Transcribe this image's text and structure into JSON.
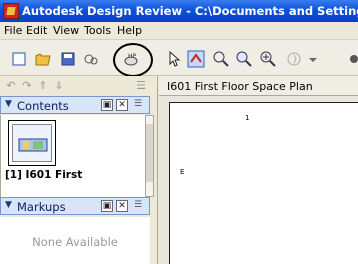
{
  "window": {
    "title": "Autodesk Design Review - C:\\Documents and Settings\\admini"
  },
  "menu": [
    "File",
    "Edit",
    "View",
    "Tools",
    "Help"
  ],
  "toolbar": {
    "buttons": [
      "new-icon",
      "open-icon",
      "save-icon",
      "print-icon",
      "publish-icon",
      "select-icon",
      "pan-icon",
      "zoom-rectangle-icon",
      "zoom-icon",
      "zoom-extents-icon",
      "orbit-icon"
    ]
  },
  "left_panel": {
    "contents": {
      "label": "Contents",
      "items": [
        {
          "label": "[1] I601 First"
        }
      ]
    },
    "markups": {
      "label": "Markups",
      "empty_text": "None Available"
    }
  },
  "drawing": {
    "tab_title": "I601 First Floor Space Plan",
    "grid_marks": [
      "1",
      "E"
    ]
  }
}
